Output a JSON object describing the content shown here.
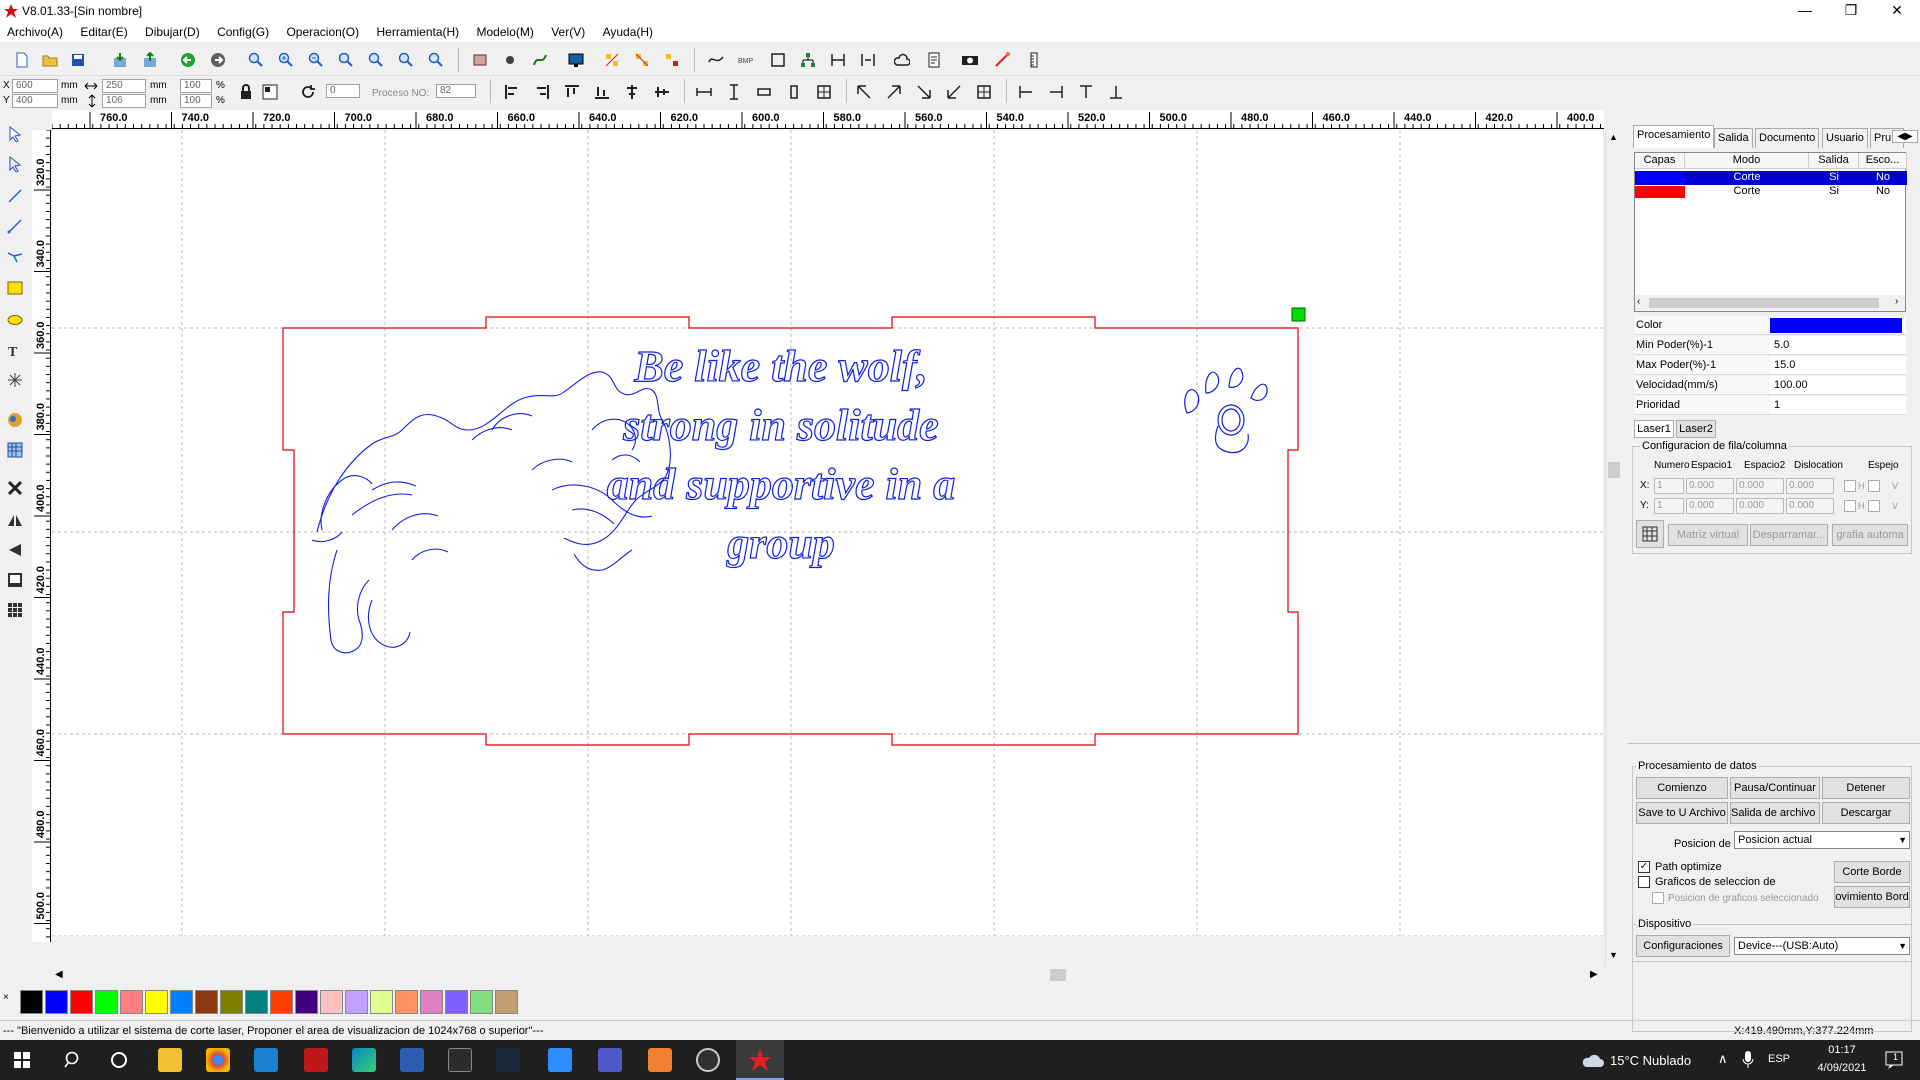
{
  "window": {
    "title": "V8.01.33-[Sin nombre]",
    "minimize": "—",
    "restore": "❐",
    "close": "✕"
  },
  "menu": [
    "Archivo(A)",
    "Editar(E)",
    "Dibujar(D)",
    "Config(G)",
    "Operacion(O)",
    "Herramienta(H)",
    "Modelo(M)",
    "Ver(V)",
    "Ayuda(H)"
  ],
  "dims": {
    "x_label": "X",
    "y_label": "Y",
    "x": "600",
    "y": "400",
    "w": "250",
    "h": "106",
    "mm": "mm",
    "sx": "100",
    "sy": "100",
    "pct": "%",
    "rotate": "0",
    "proceso_label": "Proceso NO:",
    "proceso": "82"
  },
  "ruler_top": [
    "760.0",
    "740.0",
    "720.0",
    "700.0",
    "680.0",
    "660.0",
    "640.0",
    "620.0",
    "600.0",
    "580.0",
    "560.0",
    "540.0",
    "520.0",
    "500.0",
    "480.0",
    "460.0",
    "440.0",
    "420.0",
    "400.0"
  ],
  "ruler_left": [
    "320.0",
    "340.0",
    "360.0",
    "380.0",
    "400.0",
    "420.0",
    "440.0",
    "460.0",
    "480.0",
    "500.0"
  ],
  "design_text": [
    "Be like the wolf,",
    "strong in solitude",
    "and supportive in a",
    "group"
  ],
  "tabs": [
    "Procesamiento",
    "Salida",
    "Documento",
    "Usuario",
    "Pru..."
  ],
  "layer_table": {
    "headers": [
      "Capas",
      "Modo",
      "Salida",
      "Esco..."
    ],
    "rows": [
      {
        "color": "#0000ff",
        "mode": "Corte",
        "output": "Si",
        "hide": "No"
      },
      {
        "color": "#ff0000",
        "mode": "Corte",
        "output": "Si",
        "hide": "No"
      }
    ]
  },
  "props": [
    {
      "label": "Color",
      "value": ""
    },
    {
      "label": "Min Poder(%)-1",
      "value": "5.0"
    },
    {
      "label": "Max Poder(%)-1",
      "value": "15.0"
    },
    {
      "label": "Velocidad(mm/s)",
      "value": "100.00"
    },
    {
      "label": "Prioridad",
      "value": "1"
    }
  ],
  "prop_color": "#0000ff",
  "laser_tabs": [
    "Laser1",
    "Laser2"
  ],
  "rowcol": {
    "title": "Configuracion de fila/columna",
    "headers": [
      "Numero",
      "Espacio1",
      "Espacio2",
      "Dislocation",
      "Espejo"
    ],
    "x_label": "X:",
    "y_label": "Y:",
    "x_vals": [
      "1",
      "0.000",
      "0.000",
      "0.000"
    ],
    "y_vals": [
      "1",
      "0.000",
      "0.000",
      "0.000"
    ],
    "h": "H",
    "v": "V",
    "buttons": [
      "Matriz virtual",
      "Desparramar...",
      "grafia automa"
    ]
  },
  "data_proc": {
    "title": "Procesamiento de datos",
    "buttons": [
      "Comienzo",
      "Pausa/Continuar",
      "Detener",
      "Save to U Archivo",
      "Salida de archivo U",
      "Descargar"
    ],
    "pos_label": "Posicion de",
    "pos_value": "Posicion actual",
    "path_optimize": "Path optimize",
    "graficos": "Graficos de seleccion de",
    "pos_graficos": "Posicion de graficos seleccionado",
    "corte_borde": "Corte Borde",
    "mov_borde": "ovimiento Bord"
  },
  "device": {
    "title": "Dispositivo",
    "config_btn": "Configuraciones",
    "value": "Device---(USB:Auto)"
  },
  "palette": [
    "#000000",
    "#0000ff",
    "#ff0000",
    "#00ff00",
    "#ff8080",
    "#ffff00",
    "#0080ff",
    "#8b3a0f",
    "#808000",
    "#008080",
    "#ff4000",
    "#400080",
    "#ffc0c0",
    "#c0a0ff",
    "#e0ff90",
    "#ff9060",
    "#e080c0",
    "#8060ff",
    "#80e080",
    "#c0a070"
  ],
  "status": {
    "message": "--- \"Bienvenido a utilizar el sistema de corte laser, Proponer el area de visualizacion de 1024x768 o superior\"---",
    "coords": "X:419.490mm,Y:377.224mm"
  },
  "taskbar": {
    "weather": "15°C  Nublado",
    "lang": "ESP",
    "time": "01:17",
    "date": "4/09/2021",
    "notif": "1"
  }
}
